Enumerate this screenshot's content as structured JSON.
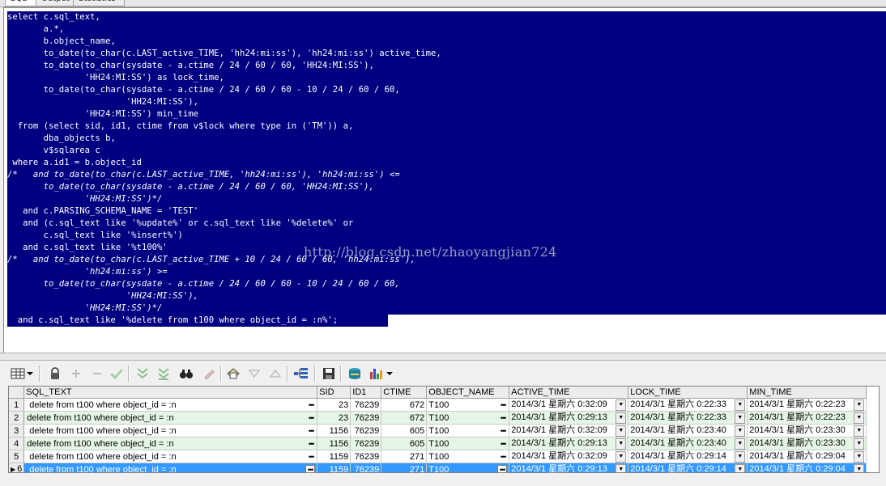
{
  "tabs": [
    "SQL",
    "Output",
    "Statistics"
  ],
  "sql_lines": [
    "select c.sql_text,",
    "       a.*,",
    "       b.object_name,",
    "       to_date(to_char(c.LAST_active_TIME, 'hh24:mi:ss'), 'hh24:mi:ss') active_time,",
    "       to_date(to_char(sysdate - a.ctime / 24 / 60 / 60, 'HH24:MI:SS'),",
    "               'HH24:MI:SS') as lock_time,",
    "       to_date(to_char(sysdate - a.ctime / 24 / 60 / 60 - 10 / 24 / 60 / 60,",
    "                       'HH24:MI:SS'),",
    "               'HH24:MI:SS') min_time",
    "  from (select sid, id1, ctime from v$lock where type in ('TM')) a,",
    "       dba_objects b,",
    "       v$sqlarea c",
    " where a.id1 = b.object_id",
    "/*   and to_date(to_char(c.LAST_active_TIME, 'hh24:mi:ss'), 'hh24:mi:ss') <=",
    "       to_date(to_char(sysdate - a.ctime / 24 / 60 / 60, 'HH24:MI:SS'),",
    "               'HH24:MI:SS')*/",
    "   and c.PARSING_SCHEMA_NAME = 'TEST'",
    "   and (c.sql_text like '%update%' or c.sql_text like '%delete%' or",
    "       c.sql_text like '%insert%')",
    "   and c.sql_text like '%t100%'",
    "/*   and to_date(to_char(c.LAST_active_TIME + 10 / 24 / 60 / 60, 'hh24:mi:ss'),",
    "               'hh24:mi:ss') >=",
    "       to_date(to_char(sysdate - a.ctime / 24 / 60 / 60 - 10 / 24 / 60 / 60,",
    "                       'HH24:MI:SS'),",
    "               'HH24:MI:SS')*/",
    "  and c.sql_text like '%delete from t100 where object_id = :n%';"
  ],
  "watermark": "http://blog.csdn.net/zhaoyangjian724",
  "toolbar": {
    "icons": [
      "grid-icon",
      "lock-icon",
      "add-icon",
      "remove-icon",
      "check-icon",
      "fetch-next-icon",
      "fetch-all-icon",
      "find-icon",
      "clear-icon",
      "query-by-example-icon",
      "sort-desc-icon",
      "sort-asc-icon",
      "link-icon",
      "save-icon",
      "export-icon",
      "chart-icon"
    ]
  },
  "grid": {
    "columns": [
      "SQL_TEXT",
      "SID",
      "ID1",
      "CTIME",
      "OBJECT_NAME",
      "ACTIVE_TIME",
      "LOCK_TIME",
      "MIN_TIME"
    ],
    "rows": [
      {
        "n": "1",
        "sql_text": "delete from t100 where object_id = :n",
        "sid": "23",
        "id1": "76239",
        "ctime": "672",
        "object_name": "T100",
        "active_time": "2014/3/1 星期六 0:32:09",
        "lock_time": "2014/3/1 星期六 0:22:33",
        "min_time": "2014/3/1 星期六 0:22:23"
      },
      {
        "n": "2",
        "sql_text": "delete from t100 where object_id = :n",
        "sid": "23",
        "id1": "76239",
        "ctime": "672",
        "object_name": "T100",
        "active_time": "2014/3/1 星期六 0:29:13",
        "lock_time": "2014/3/1 星期六 0:22:33",
        "min_time": "2014/3/1 星期六 0:22:23"
      },
      {
        "n": "3",
        "sql_text": "delete from t100 where object_id = :n",
        "sid": "1156",
        "id1": "76239",
        "ctime": "605",
        "object_name": "T100",
        "active_time": "2014/3/1 星期六 0:32:09",
        "lock_time": "2014/3/1 星期六 0:23:40",
        "min_time": "2014/3/1 星期六 0:23:30"
      },
      {
        "n": "4",
        "sql_text": "delete from t100 where object_id = :n",
        "sid": "1156",
        "id1": "76239",
        "ctime": "605",
        "object_name": "T100",
        "active_time": "2014/3/1 星期六 0:29:13",
        "lock_time": "2014/3/1 星期六 0:23:40",
        "min_time": "2014/3/1 星期六 0:23:30"
      },
      {
        "n": "5",
        "sql_text": "delete from t100 where object_id = :n",
        "sid": "1159",
        "id1": "76239",
        "ctime": "271",
        "object_name": "T100",
        "active_time": "2014/3/1 星期六 0:32:09",
        "lock_time": "2014/3/1 星期六 0:29:14",
        "min_time": "2014/3/1 星期六 0:29:04"
      },
      {
        "n": "6",
        "sql_text": "delete from t100 where object_id = :n",
        "sid": "1159",
        "id1": "76239",
        "ctime": "271",
        "object_name": "T100",
        "active_time": "2014/3/1 星期六 0:29:13",
        "lock_time": "2014/3/1 星期六 0:29:14",
        "min_time": "2014/3/1 星期六 0:29:04"
      }
    ],
    "selected_row": "6"
  },
  "colors": {
    "selection": "#000080",
    "row_alt": "#e6f6e6",
    "row_selected": "#3399ff"
  }
}
